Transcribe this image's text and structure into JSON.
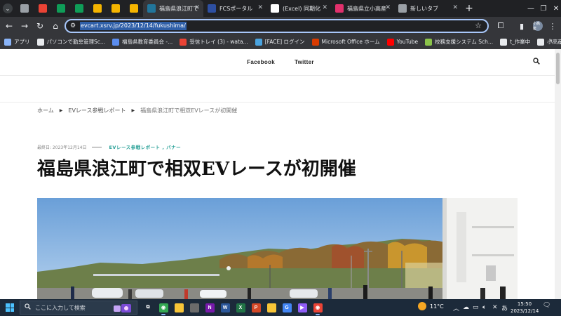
{
  "browser": {
    "tabs": [
      {
        "label": "福島県浪江町で",
        "favicon": "wordpress-icon",
        "color": "#21759b",
        "active": true
      },
      {
        "label": "FCSポータル",
        "favicon": "fcs-icon",
        "color": "#2d4fa1",
        "active": false
      },
      {
        "label": "(Excel) 同期化",
        "favicon": "docs-icon",
        "color": "#ffffff",
        "active": false
      },
      {
        "label": "福島県立小高産",
        "favicon": "instagram-icon",
        "color": "#e1306c",
        "active": false
      },
      {
        "label": "新しいタブ",
        "favicon": "chrome-icon",
        "color": "#9aa0a6",
        "active": false
      }
    ],
    "pinned_tabs": [
      {
        "icon": "globe-icon",
        "color": "#9aa0a6"
      },
      {
        "icon": "gmail-icon",
        "color": "#ea4335"
      },
      {
        "icon": "sheets-icon",
        "color": "#0f9d58"
      },
      {
        "icon": "sheets-icon",
        "color": "#0f9d58"
      },
      {
        "icon": "slides-icon",
        "color": "#f4b400"
      },
      {
        "icon": "slides-icon",
        "color": "#f4b400"
      },
      {
        "icon": "slides-icon",
        "color": "#f4b400"
      }
    ],
    "url": "evcart.xsrv.jp/2023/12/14/fukushima/",
    "profile_initials": "小高産",
    "bookmarks": [
      {
        "label": "アプリ",
        "icon": "apps-grid-icon",
        "color": "#8ab4f8"
      },
      {
        "label": "パソコンで勤怠管理Sc...",
        "icon": "github-icon",
        "color": "#e8eaed"
      },
      {
        "label": "福島県教育委員会 -...",
        "icon": "site-icon",
        "color": "#5b8def"
      },
      {
        "label": "受信トレイ (3) - wata...",
        "icon": "gmail-icon",
        "color": "#ea4335"
      },
      {
        "label": "[FACE] ログイン",
        "icon": "face-icon",
        "color": "#4aa3df"
      },
      {
        "label": "Microsoft Office ホーム",
        "icon": "office-icon",
        "color": "#d83b01"
      },
      {
        "label": "YouTube",
        "icon": "youtube-icon",
        "color": "#ff0000"
      },
      {
        "label": "校務支援システム Sch...",
        "icon": "school-icon",
        "color": "#8bc34a"
      },
      {
        "label": "t_作業中",
        "icon": "folder-icon",
        "color": "#e8eaed"
      },
      {
        "label": "小高産業技術",
        "icon": "folder-icon",
        "color": "#e8eaed"
      }
    ]
  },
  "site": {
    "nav": [
      "Facebook",
      "Twitter"
    ],
    "breadcrumb": {
      "home": "ホーム",
      "category": "EVレース参戦レポート",
      "current": "福島県浪江町で相双EVレースが初開催"
    },
    "meta": {
      "updated": "最終日: 2023年12月14日",
      "categories": "EVレース参戦レポート , バナー"
    },
    "title": "福島県浪江町で相双EVレースが初開催"
  },
  "taskbar": {
    "search_placeholder": "ここに入力して検索",
    "apps": [
      {
        "icon": "task-view-icon",
        "color": "#ffffff",
        "glyph": "⧉"
      },
      {
        "icon": "chrome-icon",
        "color": "#34a853",
        "glyph": "◉"
      },
      {
        "icon": "file-explorer-icon",
        "color": "#f8c537",
        "glyph": ""
      },
      {
        "icon": "calculator-icon",
        "color": "#6b6b6b",
        "glyph": ""
      },
      {
        "icon": "onenote-icon",
        "color": "#7719aa",
        "glyph": "N"
      },
      {
        "icon": "word-icon",
        "color": "#2b579a",
        "glyph": "W"
      },
      {
        "icon": "excel-icon",
        "color": "#217346",
        "glyph": "X"
      },
      {
        "icon": "powerpoint-icon",
        "color": "#d24726",
        "glyph": "P"
      },
      {
        "icon": "photos-icon",
        "color": "#f8c537",
        "glyph": ""
      },
      {
        "icon": "google-icon",
        "color": "#4285f4",
        "glyph": "G"
      },
      {
        "icon": "media-player-icon",
        "color": "#8e5cf6",
        "glyph": "▶"
      },
      {
        "icon": "chrome-icon",
        "color": "#ea4335",
        "glyph": "◉"
      }
    ],
    "temperature": "11°C",
    "ime": "あ",
    "time": "15:50",
    "date": "2023/12/14"
  }
}
